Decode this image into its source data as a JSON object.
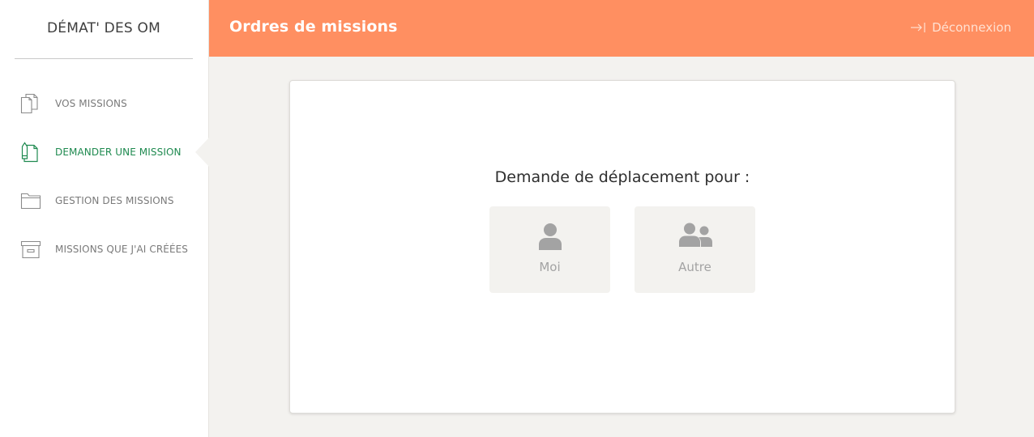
{
  "sidebar": {
    "brand": "DÉMAT' DES OM",
    "items": [
      {
        "label": "VOS MISSIONS",
        "icon": "documents-icon",
        "active": false
      },
      {
        "label": "DEMANDER UNE MISSION",
        "icon": "document-pen-icon",
        "active": true
      },
      {
        "label": "GESTION DES MISSIONS",
        "icon": "folder-icon",
        "active": false
      },
      {
        "label": "MISSIONS QUE J'AI CRÉÉES",
        "icon": "archive-box-icon",
        "active": false
      }
    ]
  },
  "header": {
    "title": "Ordres de missions",
    "logout_label": "Déconnexion",
    "logout_icon": "logout-arrow-icon"
  },
  "main": {
    "prompt": "Demande de déplacement pour :",
    "choices": [
      {
        "label": "Moi",
        "icon": "single-user-icon"
      },
      {
        "label": "Autre",
        "icon": "user-group-icon"
      }
    ]
  },
  "colors": {
    "accent": "#ff8f61",
    "active_nav": "#1f8a50",
    "background": "#f3f2ef"
  }
}
